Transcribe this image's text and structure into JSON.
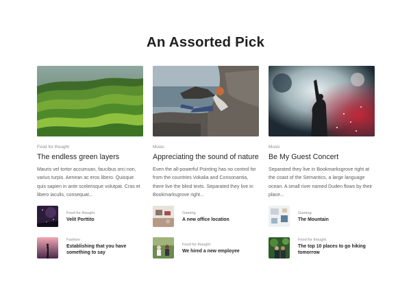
{
  "section": {
    "title": "An Assorted Pick"
  },
  "featured": [
    {
      "category": "Food for thought",
      "title": "The endless green layers",
      "excerpt": "Mauris vel tortor accumsan, faucibus orci non, varius turpis. Aenean ac eros libero. Quisque quis sapien in ante scelerisque volutpat. Cras et libero iaculis, consequat...",
      "image": "green-hills-landscape"
    },
    {
      "category": "Music",
      "title": "Appreciating the sound of nature",
      "excerpt": "Even the all-powerful Pointing has no control for from the countries Vokalia and Consonantia, there live the blind texts. Separated they live in Bookmarksgrove right...",
      "image": "woman-on-seaside-rocks"
    },
    {
      "category": "Music",
      "title": "Be My Guest Concert",
      "excerpt": "Separated they live in Bookmarksgrove right at the coast of the Semantics, a large language ocean. A small river named Duden flows by their place...",
      "image": "concert-performer-smoke"
    }
  ],
  "mini_posts": [
    {
      "category": "Food for thought",
      "title": "Velit Porttito",
      "image": "night-sky"
    },
    {
      "category": "Gaming",
      "title": "A new office location",
      "image": "office-desk"
    },
    {
      "category": "Gaming",
      "title": "The Mountain",
      "image": "workspace"
    },
    {
      "category": "Fashion",
      "title": "Establishing that you have something to say",
      "image": "sunset-silhouette"
    },
    {
      "category": "Food for thought",
      "title": "We hired a new employee",
      "image": "people-outdoors"
    },
    {
      "category": "Food for thought",
      "title": "The top 10 places to go hiking tomorrow",
      "image": "green-friends"
    }
  ]
}
